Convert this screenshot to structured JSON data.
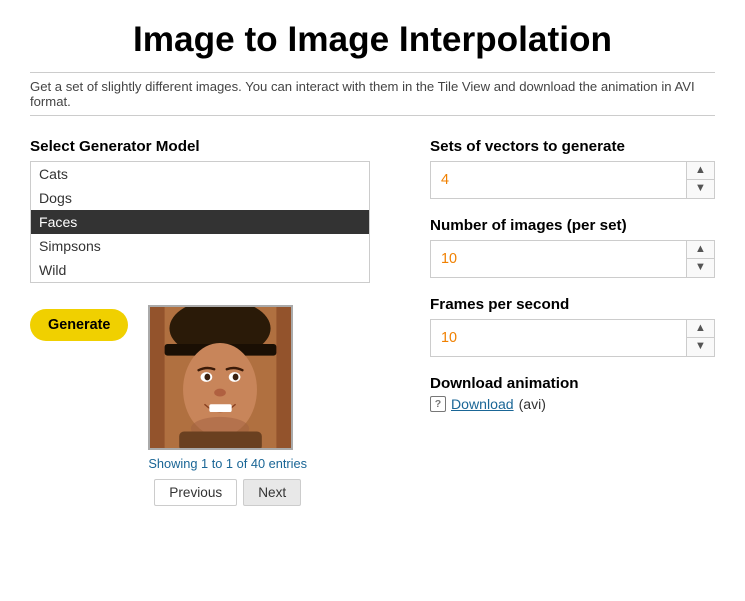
{
  "page": {
    "title": "Image to Image Interpolation",
    "subtitle": "Get a set of slightly different images. You can interact with them in the Tile View and download the animation in AVI format."
  },
  "left": {
    "model_label": "Select Generator Model",
    "models": [
      "Cats",
      "Dogs",
      "Faces",
      "Simpsons",
      "Wild"
    ],
    "selected_model": "Faces",
    "generate_label": "Generate",
    "showing_text": "Showing 1 to 1 of 40 entries",
    "pagination": {
      "previous": "Previous",
      "next": "Next"
    }
  },
  "right": {
    "sets_label": "Sets of vectors to generate",
    "sets_value": "4",
    "images_label": "Number of images (per set)",
    "images_value": "10",
    "fps_label": "Frames per second",
    "fps_value": "10",
    "download_label": "Download animation",
    "download_icon_label": "?",
    "download_link_text": "Download",
    "download_format": "(avi)"
  }
}
